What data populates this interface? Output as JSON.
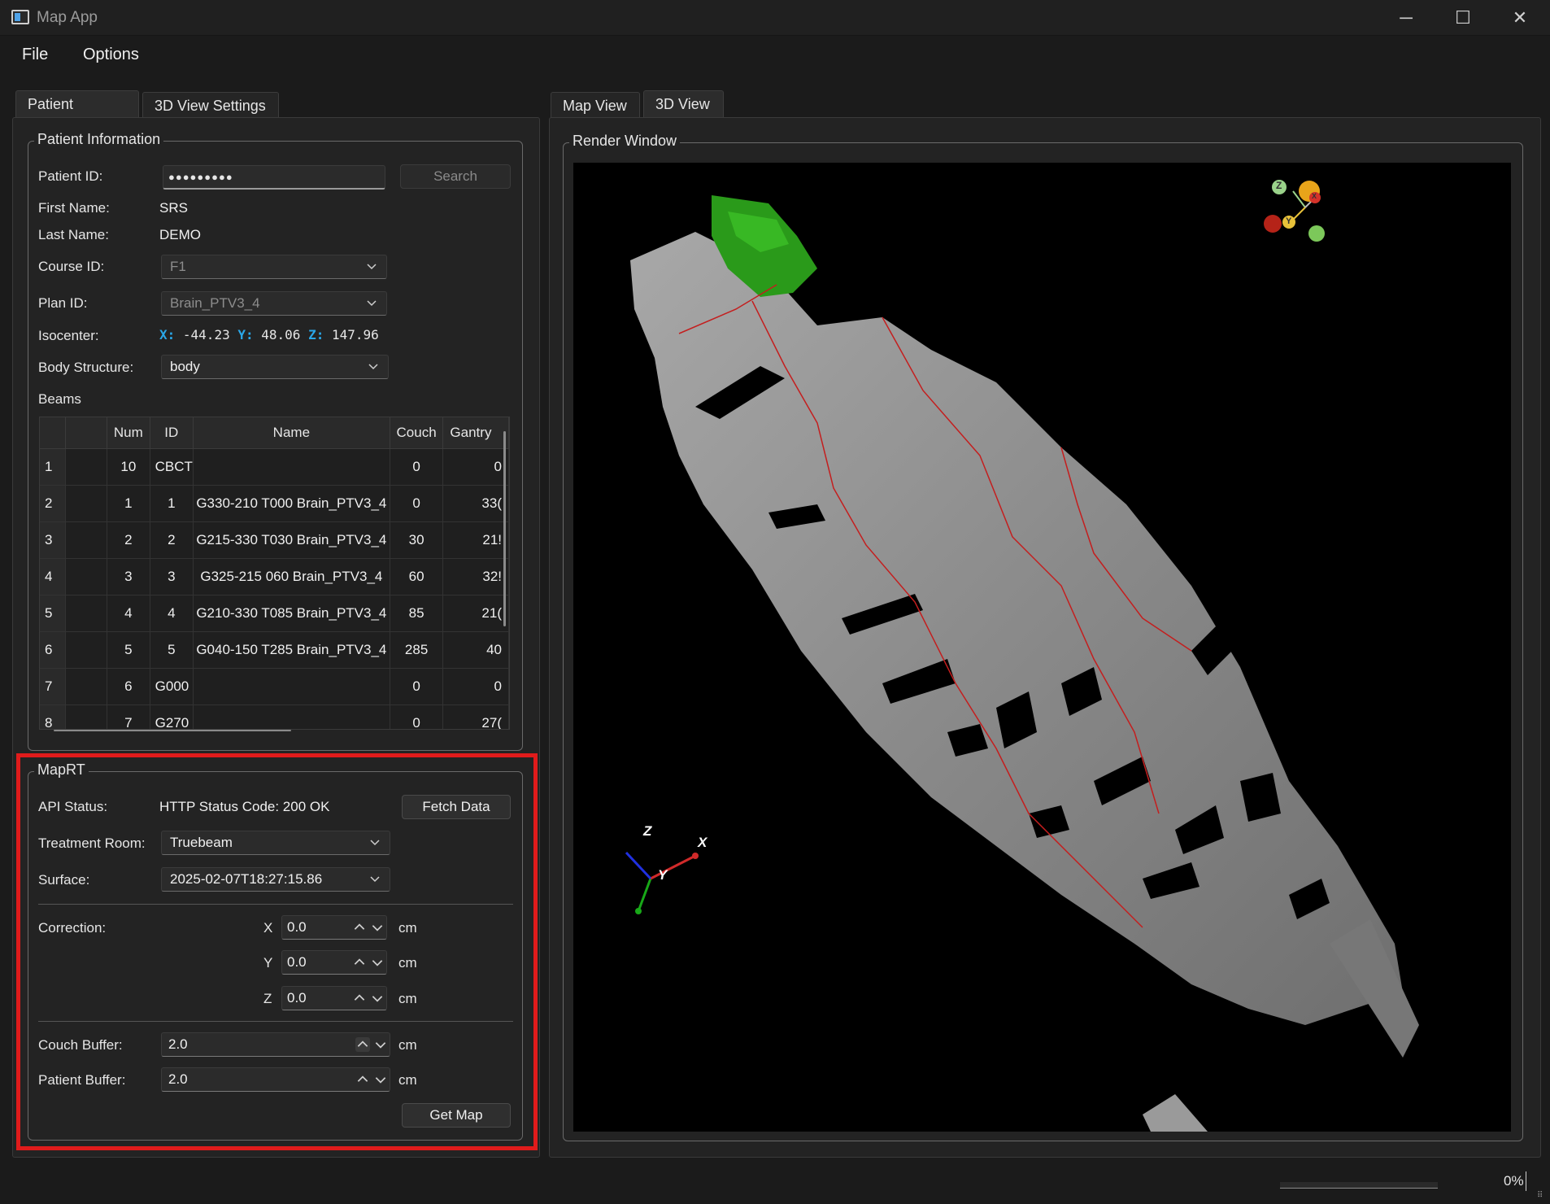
{
  "window": {
    "title": "Map App",
    "controls": {
      "minimize": "─",
      "maximize": "☐",
      "close": "✕"
    }
  },
  "menu": {
    "items": [
      "File",
      "Options"
    ]
  },
  "left_tabs": [
    {
      "label": "Patient Context",
      "active": true
    },
    {
      "label": "3D View Settings",
      "active": false
    }
  ],
  "right_tabs": [
    {
      "label": "Map View",
      "active": false
    },
    {
      "label": "3D View",
      "active": true
    }
  ],
  "patient": {
    "group_title": "Patient Information",
    "patient_id_label": "Patient ID:",
    "patient_id_value": "●●●●●●●●●",
    "search_label": "Search",
    "first_name_label": "First Name:",
    "first_name": "SRS",
    "last_name_label": "Last Name:",
    "last_name": "DEMO",
    "course_id_label": "Course ID:",
    "course_id": "F1",
    "plan_id_label": "Plan ID:",
    "plan_id": "Brain_PTV3_4",
    "isocenter_label": "Isocenter:",
    "iso_x_label": "X:",
    "iso_x": "-44.23",
    "iso_y_label": "Y:",
    "iso_y": "48.06",
    "iso_z_label": "Z:",
    "iso_z": "147.96",
    "body_structure_label": "Body Structure:",
    "body_structure": "body",
    "beams_label": "Beams"
  },
  "beams": {
    "columns": [
      "",
      "Num",
      "ID",
      "Name",
      "Couch",
      "Gantry"
    ],
    "rows": [
      [
        "1",
        "10",
        "CBCT",
        "",
        "0",
        "0"
      ],
      [
        "2",
        "1",
        "1",
        "G330-210 T000 Brain_PTV3_4",
        "0",
        "33("
      ],
      [
        "3",
        "2",
        "2",
        "G215-330 T030 Brain_PTV3_4",
        "30",
        "21!"
      ],
      [
        "4",
        "3",
        "3",
        "G325-215 060 Brain_PTV3_4",
        "60",
        "32!"
      ],
      [
        "5",
        "4",
        "4",
        "G210-330 T085 Brain_PTV3_4",
        "85",
        "21("
      ],
      [
        "6",
        "5",
        "5",
        "G040-150 T285 Brain_PTV3_4",
        "285",
        "40"
      ],
      [
        "7",
        "6",
        "G000",
        "",
        "0",
        "0"
      ],
      [
        "8",
        "7",
        "G270",
        "",
        "0",
        "27("
      ]
    ]
  },
  "maprt": {
    "group_title": "MapRT",
    "api_status_label": "API Status:",
    "api_status": "HTTP Status Code: 200 OK",
    "fetch_label": "Fetch Data",
    "room_label": "Treatment Room:",
    "room": "Truebeam",
    "surface_label": "Surface:",
    "surface": "2025-02-07T18:27:15.86",
    "correction_label": "Correction:",
    "x_label": "X",
    "x_value": "0.0",
    "y_label": "Y",
    "y_value": "0.0",
    "z_label": "Z",
    "z_value": "0.0",
    "unit": "cm",
    "couch_buffer_label": "Couch Buffer:",
    "couch_buffer": "2.0",
    "patient_buffer_label": "Patient Buffer:",
    "patient_buffer": "2.0",
    "get_map_label": "Get Map"
  },
  "render": {
    "group_title": "Render Window",
    "axes_x": "X",
    "axes_y": "Y",
    "axes_z": "Z",
    "orient_z": "Z",
    "orient_y": "Y",
    "orient_x": "X"
  },
  "colors": {
    "highlight_box": "#e01b1b",
    "mesh": "#8c8c8c",
    "structure_green": "#2a9a1a",
    "contour_red": "#c41e1e",
    "iso_label_blue": "#2aa7e8"
  },
  "status": {
    "progress_text": "0%",
    "progress_value": 0
  }
}
